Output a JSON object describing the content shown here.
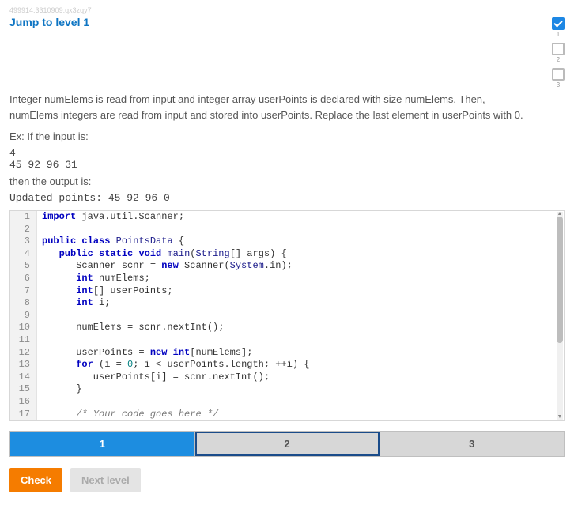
{
  "top_hash": "499914.3310909.qx3zqy7",
  "jump_label": "Jump to level 1",
  "right_checks": [
    {
      "num": "1",
      "checked": true
    },
    {
      "num": "2",
      "checked": false
    },
    {
      "num": "3",
      "checked": false
    }
  ],
  "description": "Integer numElems is read from input and integer array userPoints is declared with size numElems. Then, numElems integers are read from input and stored into userPoints. Replace the last element in userPoints with 0.",
  "ex_label": "Ex: If the input is:",
  "ex_input_line1": "4",
  "ex_input_line2": "45 92 96 31",
  "then_label": "then the output is:",
  "ex_output": "Updated points: 45 92 96 0",
  "code_lines": [
    {
      "n": "1",
      "tokens": [
        [
          "kw",
          "import"
        ],
        [
          "",
          " java.util.Scanner;"
        ]
      ]
    },
    {
      "n": "2",
      "tokens": [
        [
          "",
          ""
        ]
      ]
    },
    {
      "n": "3",
      "tokens": [
        [
          "kw",
          "public"
        ],
        [
          "",
          " "
        ],
        [
          "kw",
          "class"
        ],
        [
          "",
          " "
        ],
        [
          "cls",
          "PointsData"
        ],
        [
          "",
          " {"
        ]
      ]
    },
    {
      "n": "4",
      "tokens": [
        [
          "",
          "   "
        ],
        [
          "kw",
          "public"
        ],
        [
          "",
          " "
        ],
        [
          "kw",
          "static"
        ],
        [
          "",
          " "
        ],
        [
          "kw",
          "void"
        ],
        [
          "",
          " "
        ],
        [
          "cls",
          "main"
        ],
        [
          "",
          "("
        ],
        [
          "cls",
          "String"
        ],
        [
          "",
          "[] args) {"
        ]
      ]
    },
    {
      "n": "5",
      "tokens": [
        [
          "",
          "      Scanner scnr = "
        ],
        [
          "kw",
          "new"
        ],
        [
          "",
          " Scanner("
        ],
        [
          "cls",
          "System"
        ],
        [
          "",
          ".in);"
        ]
      ]
    },
    {
      "n": "6",
      "tokens": [
        [
          "",
          "      "
        ],
        [
          "kw",
          "int"
        ],
        [
          "",
          " numElems;"
        ]
      ]
    },
    {
      "n": "7",
      "tokens": [
        [
          "",
          "      "
        ],
        [
          "kw",
          "int"
        ],
        [
          "",
          "[] userPoints;"
        ]
      ]
    },
    {
      "n": "8",
      "tokens": [
        [
          "",
          "      "
        ],
        [
          "kw",
          "int"
        ],
        [
          "",
          " i;"
        ]
      ]
    },
    {
      "n": "9",
      "tokens": [
        [
          "",
          ""
        ]
      ]
    },
    {
      "n": "10",
      "tokens": [
        [
          "",
          "      numElems = scnr.nextInt();"
        ]
      ]
    },
    {
      "n": "11",
      "tokens": [
        [
          "",
          ""
        ]
      ]
    },
    {
      "n": "12",
      "tokens": [
        [
          "",
          "      userPoints = "
        ],
        [
          "kw",
          "new"
        ],
        [
          "",
          " "
        ],
        [
          "kw",
          "int"
        ],
        [
          "",
          "[numElems];"
        ]
      ]
    },
    {
      "n": "13",
      "tokens": [
        [
          "",
          "      "
        ],
        [
          "kw",
          "for"
        ],
        [
          "",
          " (i = "
        ],
        [
          "num",
          "0"
        ],
        [
          "",
          "; i < userPoints.length; ++i) {"
        ]
      ]
    },
    {
      "n": "14",
      "tokens": [
        [
          "",
          "         userPoints[i] = scnr.nextInt();"
        ]
      ]
    },
    {
      "n": "15",
      "tokens": [
        [
          "",
          "      }"
        ]
      ]
    },
    {
      "n": "16",
      "tokens": [
        [
          "",
          ""
        ]
      ]
    },
    {
      "n": "17",
      "tokens": [
        [
          "",
          "      "
        ],
        [
          "cmt",
          "/* Your code goes here */"
        ]
      ]
    }
  ],
  "tabs": [
    {
      "label": "1",
      "active": true,
      "outlined": false
    },
    {
      "label": "2",
      "active": false,
      "outlined": true
    },
    {
      "label": "3",
      "active": false,
      "outlined": false
    }
  ],
  "buttons": {
    "check": "Check",
    "next": "Next level"
  }
}
